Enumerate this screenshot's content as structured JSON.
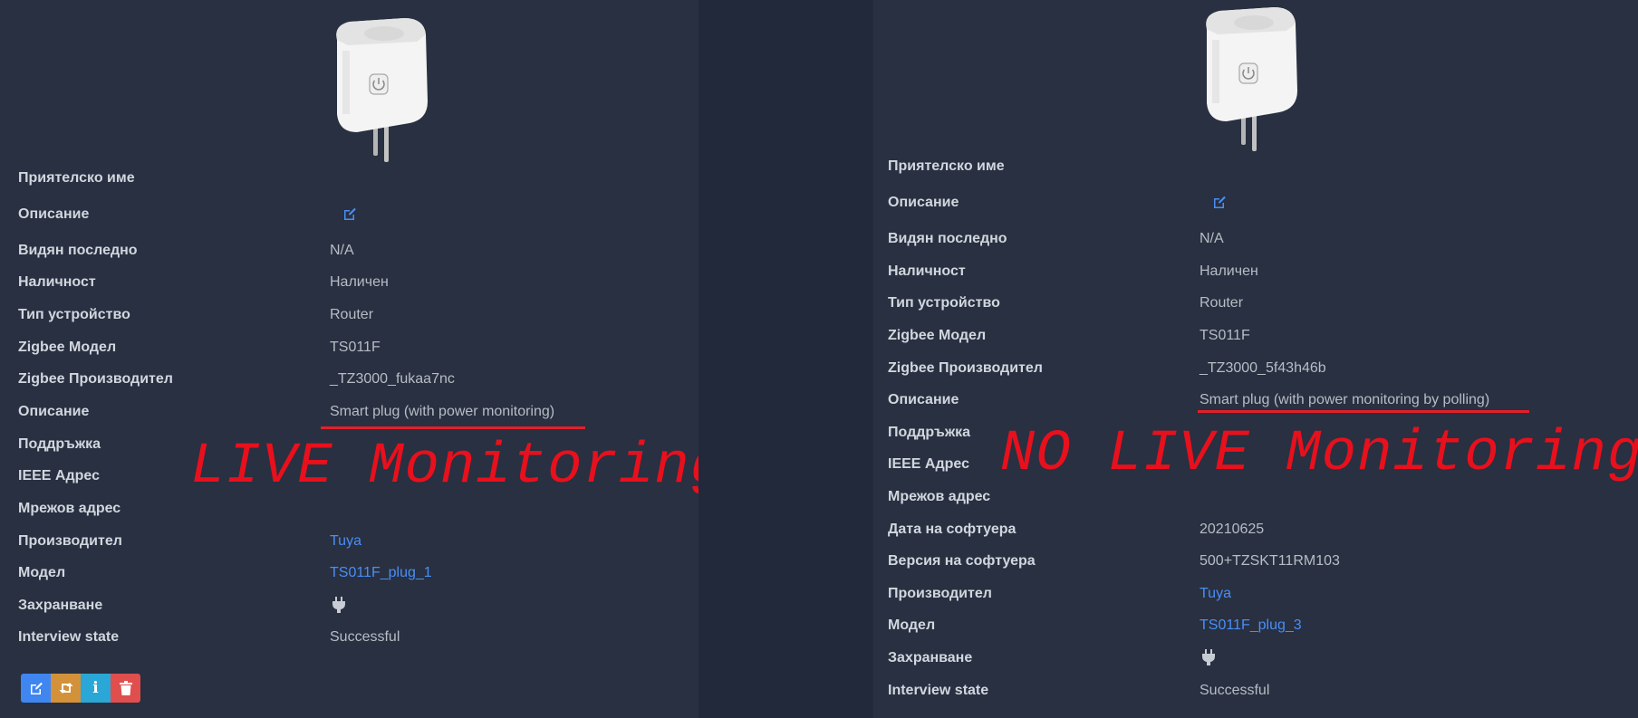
{
  "colors": {
    "panel_bg": "#283041",
    "label": "#d2d6de",
    "value": "#b8bcc5",
    "link": "#4a8ef5",
    "overlay_red": "#e8101c",
    "btn_edit": "#3f86f0",
    "btn_reconfigure": "#d3913a",
    "btn_info": "#2aa7d6",
    "btn_delete": "#e04e4e"
  },
  "left": {
    "image_alt": "smart plug",
    "rows": [
      {
        "label": "Приятелско име",
        "value": ""
      },
      {
        "label": "Описание",
        "value": "",
        "icon": "edit-icon"
      },
      {
        "label": "Видян последно",
        "value": "N/A"
      },
      {
        "label": "Наличност",
        "value": "Наличен"
      },
      {
        "label": "Тип устройство",
        "value": "Router"
      },
      {
        "label": "Zigbee Модел",
        "value": "TS011F"
      },
      {
        "label": "Zigbee Производител",
        "value": "_TZ3000_fukaa7nc"
      },
      {
        "label": "Описание",
        "value": "Smart plug (with power monitoring)"
      },
      {
        "label": "Поддръжка",
        "value": ""
      },
      {
        "label": "IEEE Адрес",
        "value": ""
      },
      {
        "label": "Мрежов адрес",
        "value": ""
      },
      {
        "label": "Производител",
        "value": "Tuya"
      },
      {
        "label": "Модел",
        "value": "TS011F_plug_1"
      },
      {
        "label": "Захранване",
        "value": "",
        "icon": "power-plug-icon"
      },
      {
        "label": "Interview state",
        "value": "Successful"
      }
    ],
    "overlay": "LIVE Monitoring",
    "buttons": [
      {
        "name": "edit-button",
        "icon": "edit-icon"
      },
      {
        "name": "reconfigure-button",
        "icon": "retweet-icon"
      },
      {
        "name": "info-button",
        "icon": "info-icon",
        "glyph": "i"
      },
      {
        "name": "delete-button",
        "icon": "trash-icon"
      }
    ]
  },
  "right": {
    "image_alt": "smart plug",
    "rows": [
      {
        "label": "Приятелско име",
        "value": ""
      },
      {
        "label": "Описание",
        "value": "",
        "icon": "edit-icon"
      },
      {
        "label": "Видян последно",
        "value": "N/A"
      },
      {
        "label": "Наличност",
        "value": "Наличен"
      },
      {
        "label": "Тип устройство",
        "value": "Router"
      },
      {
        "label": "Zigbee Модел",
        "value": "TS011F"
      },
      {
        "label": "Zigbee Производител",
        "value": "_TZ3000_5f43h46b"
      },
      {
        "label": "Описание",
        "value": "Smart plug (with power monitoring by polling)"
      },
      {
        "label": "Поддръжка",
        "value": ""
      },
      {
        "label": "IEEE Адрес",
        "value": ""
      },
      {
        "label": "Мрежов адрес",
        "value": ""
      },
      {
        "label": "Дата на софтуера",
        "value": "20210625"
      },
      {
        "label": "Версия на софтуера",
        "value": "500+TZSKT11RM103"
      },
      {
        "label": "Производител",
        "value": "Tuya"
      },
      {
        "label": "Модел",
        "value": "TS011F_plug_3"
      },
      {
        "label": "Захранване",
        "value": "",
        "icon": "power-plug-icon"
      },
      {
        "label": "Interview state",
        "value": "Successful"
      }
    ],
    "overlay": "NO LIVE Monitoring"
  }
}
